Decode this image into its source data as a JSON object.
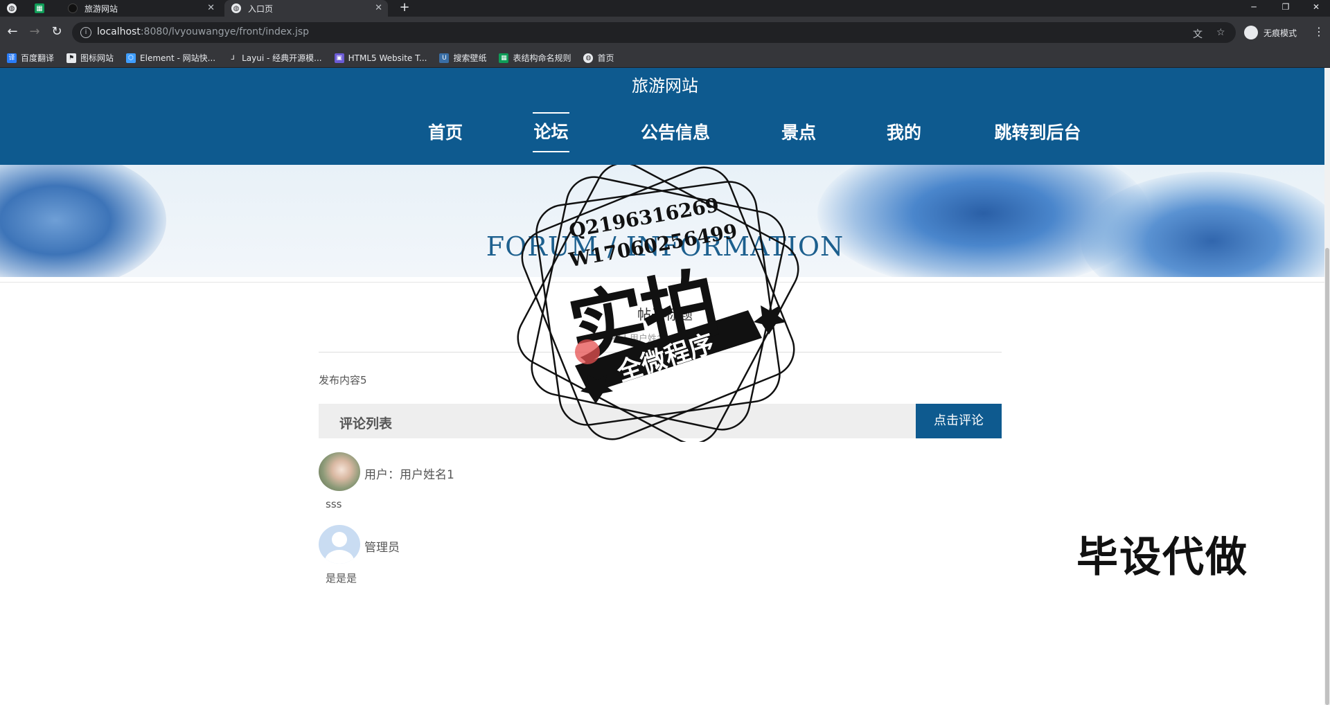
{
  "browser": {
    "tabs": [
      {
        "title": "旅游网站",
        "active": false
      },
      {
        "title": "入口页",
        "active": true
      }
    ],
    "url_host": "localhost",
    "url_rest": ":8080/lvyouwangye/front/index.jsp",
    "profile_label": "无痕模式",
    "bookmarks": [
      {
        "label": "百度翻译",
        "icon": "translate-icon",
        "color": "#2a7cf7"
      },
      {
        "label": "图标网站",
        "icon": "flag-icon",
        "color": "#444"
      },
      {
        "label": "Element - 网站快...",
        "icon": "element-icon",
        "color": "#409eff"
      },
      {
        "label": "Layui - 经典开源模...",
        "icon": "layui-icon",
        "color": "#888"
      },
      {
        "label": "HTML5 Website T...",
        "icon": "html5-icon",
        "color": "#6b5bd6"
      },
      {
        "label": "搜索壁纸",
        "icon": "wallpaper-icon",
        "color": "#3a6ea5"
      },
      {
        "label": "表结构命名规则",
        "icon": "sheet-icon",
        "color": "#0f9d58"
      },
      {
        "label": "首页",
        "icon": "globe-icon",
        "color": "#777"
      }
    ]
  },
  "site": {
    "title": "旅游网站",
    "nav": [
      {
        "label": "首页",
        "active": false
      },
      {
        "label": "论坛",
        "active": true
      },
      {
        "label": "公告信息",
        "active": false
      },
      {
        "label": "景点",
        "active": false
      },
      {
        "label": "我的",
        "active": false
      },
      {
        "label": "跳转到后台",
        "active": false
      }
    ]
  },
  "forum": {
    "section_title": "FORUM / INFORMATION",
    "post_title": "帖子标题",
    "post_meta": "发布人用户姓名：   时间：2022",
    "post_content": "发布内容5",
    "comment_list_label": "评论列表",
    "comment_button": "点击评论",
    "comments": [
      {
        "user": "用户：用户姓名1",
        "text": "sss",
        "avatar": "photo"
      },
      {
        "user": "管理员",
        "text": "是是是",
        "avatar": "default"
      }
    ]
  },
  "overlay": {
    "stamp_qq": "Q2196316269",
    "stamp_wx": "W17060256499",
    "stamp_big": "实拍",
    "stamp_ribbon": "全微程序",
    "corner_watermark": "毕设代做"
  },
  "colors": {
    "brand_blue": "#0e5a8f",
    "chrome_dark": "#202124",
    "chrome_toolbar": "#35363a"
  }
}
